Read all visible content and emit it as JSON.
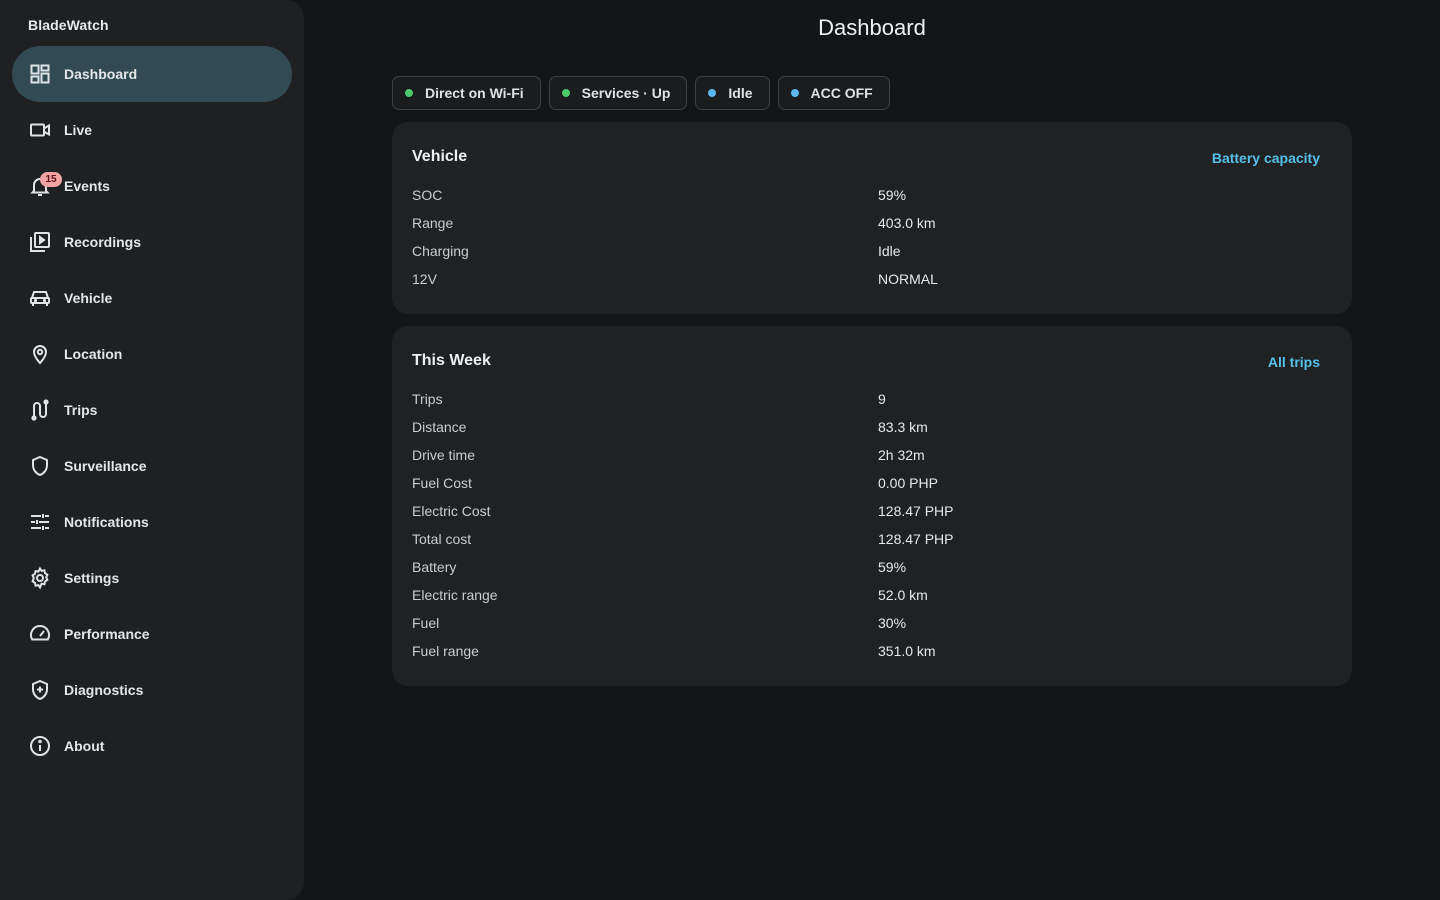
{
  "app": {
    "name": "BladeWatch"
  },
  "sidebar": {
    "items": [
      {
        "label": "Dashboard",
        "icon": "dashboard-icon",
        "active": true
      },
      {
        "label": "Live",
        "icon": "video-camera-icon"
      },
      {
        "label": "Events",
        "icon": "bell-icon",
        "badge": "15"
      },
      {
        "label": "Recordings",
        "icon": "video-library-icon"
      },
      {
        "label": "Vehicle",
        "icon": "car-icon"
      },
      {
        "label": "Location",
        "icon": "location-pin-icon"
      },
      {
        "label": "Trips",
        "icon": "route-icon"
      },
      {
        "label": "Surveillance",
        "icon": "shield-icon"
      },
      {
        "label": "Notifications",
        "icon": "tune-icon"
      },
      {
        "label": "Settings",
        "icon": "gear-icon"
      },
      {
        "label": "Performance",
        "icon": "speedometer-icon"
      },
      {
        "label": "Diagnostics",
        "icon": "health-shield-icon"
      },
      {
        "label": "About",
        "icon": "info-icon"
      }
    ]
  },
  "page": {
    "title": "Dashboard"
  },
  "status_chips": [
    {
      "label": "Direct on Wi-Fi",
      "color": "#4cc96a"
    },
    {
      "label": "Services · Up",
      "color": "#4cc96a"
    },
    {
      "label": "Idle",
      "color": "#5ab8f0"
    },
    {
      "label": "ACC OFF",
      "color": "#5ab8f0"
    }
  ],
  "vehicle_card": {
    "title": "Vehicle",
    "link": "Battery capacity",
    "rows": [
      {
        "label": "SOC",
        "value": "59%"
      },
      {
        "label": "Range",
        "value": "403.0 km"
      },
      {
        "label": "Charging",
        "value": "Idle"
      },
      {
        "label": "12V",
        "value": "NORMAL"
      }
    ]
  },
  "week_card": {
    "title": "This Week",
    "link": "All trips",
    "rows": [
      {
        "label": "Trips",
        "value": "9"
      },
      {
        "label": "Distance",
        "value": "83.3 km"
      },
      {
        "label": "Drive time",
        "value": "2h 32m"
      },
      {
        "label": "Fuel Cost",
        "value": "0.00 PHP"
      },
      {
        "label": "Electric Cost",
        "value": "128.47 PHP"
      },
      {
        "label": "Total cost",
        "value": "128.47 PHP"
      },
      {
        "label": "Battery",
        "value": "59%"
      },
      {
        "label": "Electric range",
        "value": "52.0 km"
      },
      {
        "label": "Fuel",
        "value": "30%"
      },
      {
        "label": "Fuel range",
        "value": "351.0 km"
      }
    ]
  },
  "colors": {
    "background": "#141517",
    "sidebar": "#1f2022",
    "active_item": "#324a54",
    "card": "#202123",
    "link": "#55c0ea",
    "badge": "#f2a4a4"
  }
}
